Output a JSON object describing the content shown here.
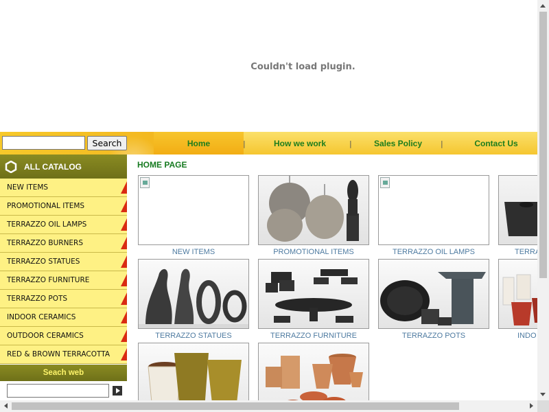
{
  "plugin": {
    "message": "Couldn't load plugin."
  },
  "search": {
    "button_label": "Search",
    "value": ""
  },
  "nav": {
    "items": [
      "Home",
      "How we work",
      "Sales Policy",
      "Contact Us"
    ],
    "separator": "|"
  },
  "sidebar": {
    "catalog_label": "ALL CATALOG",
    "items": [
      "NEW ITEMS",
      "PROMOTIONAL ITEMS",
      "TERRAZZO OIL LAMPS",
      "TERRAZZO BURNERS",
      "TERRAZZO STATUES",
      "TERRAZZO FURNITURE",
      "TERRAZZO POTS",
      "INDOOR CERAMICS",
      "OUTDOOR CERAMICS",
      "RED & BROWN TERRACOTTA"
    ],
    "web_search_label": "Seach web",
    "web_search_value": ""
  },
  "main": {
    "title": "HOME PAGE",
    "captions": [
      "NEW ITEMS",
      "PROMOTIONAL ITEMS",
      "TERRAZZO OIL LAMPS",
      "TERRA",
      "TERRAZZO STATUES",
      "TERRAZZO FURNITURE",
      "TERRAZZO POTS",
      "INDO"
    ]
  },
  "colors": {
    "nav_text": "#1d7d1d",
    "menu_bg": "#fef184",
    "menu_accent": "#d92b12",
    "header_olive": "#7c7d1d",
    "caption": "#4d7aa0"
  }
}
